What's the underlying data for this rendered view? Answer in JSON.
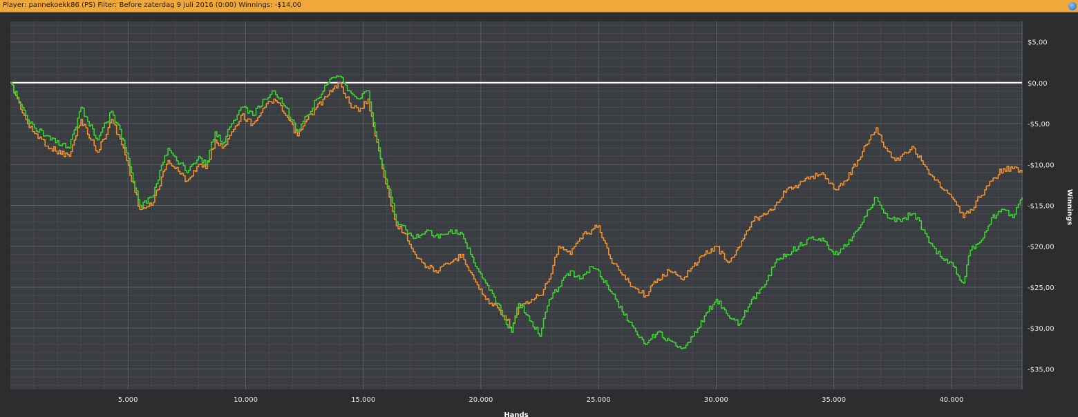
{
  "header": {
    "title": "Player: pannekoekk86 (PS) Filter: Before zaterdag 9 juli 2016 (0:00) Winnings: -$14,00"
  },
  "chart_data": {
    "type": "line",
    "xlabel": "Hands",
    "ylabel": "Winnings",
    "xlim": [
      0,
      43000
    ],
    "ylim": [
      -37.5,
      7.5
    ],
    "x_ticks": [
      5000,
      10000,
      15000,
      20000,
      25000,
      30000,
      35000,
      40000
    ],
    "x_tick_labels": [
      "5.000",
      "10.000",
      "15.000",
      "20.000",
      "25.000",
      "30.000",
      "35.000",
      "40.000"
    ],
    "y_ticks": [
      5,
      0,
      -5,
      -10,
      -15,
      -20,
      -25,
      -30,
      -35
    ],
    "y_tick_labels": [
      "$5,00",
      "$0,00",
      "-$5,00",
      "-$10,00",
      "-$15,00",
      "-$20,00",
      "-$25,00",
      "-$30,00",
      "-$35,00"
    ],
    "grid": true,
    "zero_line": 0,
    "colors": {
      "green": "#39d42f",
      "orange": "#f0912e",
      "zero": "#ffffff"
    },
    "series": [
      {
        "color": "green",
        "x": [
          0,
          800,
          1700,
          2500,
          3000,
          3700,
          4300,
          4800,
          5500,
          6000,
          6700,
          7500,
          8000,
          8300,
          8700,
          9000,
          9400,
          9800,
          10300,
          10800,
          11200,
          11700,
          12200,
          12600,
          13000,
          13500,
          14000,
          14400,
          14800,
          15200,
          15500,
          15800,
          16100,
          16400,
          16800,
          17200,
          17700,
          18200,
          18700,
          19200,
          19700,
          20200,
          20700,
          21000,
          21300,
          21600,
          22000,
          22500,
          22900,
          23300,
          23800,
          24200,
          24700,
          25000,
          25500,
          26000,
          26500,
          27000,
          27500,
          28000,
          28500,
          29000,
          29500,
          30000,
          30500,
          31000,
          31500,
          32000,
          32500,
          33000,
          33500,
          34000,
          34500,
          35000,
          35500,
          36000,
          36500,
          36800,
          37200,
          37600,
          38000,
          38400,
          38800,
          39200,
          39600,
          40000,
          40500,
          40800,
          41200,
          41700,
          42200,
          42600,
          43000
        ],
        "y": [
          0,
          -5,
          -7,
          -8,
          -3,
          -7,
          -3.5,
          -7,
          -15,
          -14,
          -8,
          -11,
          -9,
          -10,
          -6,
          -7.5,
          -5,
          -3,
          -4,
          -2,
          -1,
          -3,
          -6,
          -4,
          -2,
          0,
          0.8,
          -1,
          -2,
          -1,
          -6,
          -10,
          -13,
          -17,
          -18,
          -19,
          -18,
          -19,
          -18,
          -18.5,
          -22,
          -24.5,
          -27,
          -29,
          -30.5,
          -27,
          -28.5,
          -31,
          -26.5,
          -25,
          -23,
          -24,
          -22.5,
          -23,
          -25.5,
          -28,
          -30,
          -32,
          -30.5,
          -31.5,
          -32.5,
          -31,
          -28.5,
          -26.5,
          -28.5,
          -29.5,
          -26.5,
          -25,
          -22,
          -21,
          -20,
          -19,
          -19,
          -21,
          -20,
          -18,
          -15.5,
          -14,
          -16,
          -17,
          -16.5,
          -16,
          -18,
          -20,
          -21.5,
          -22,
          -24.5,
          -20.5,
          -19.5,
          -16.5,
          -15.5,
          -16.5,
          -14
        ]
      },
      {
        "color": "orange",
        "x": [
          0,
          800,
          1700,
          2500,
          3000,
          3700,
          4300,
          4800,
          5500,
          6000,
          6700,
          7500,
          8000,
          8300,
          8700,
          9000,
          9400,
          9800,
          10300,
          10800,
          11200,
          11700,
          12200,
          12600,
          13000,
          13500,
          14000,
          14400,
          14800,
          15200,
          15500,
          15800,
          16100,
          16400,
          16800,
          17200,
          17700,
          18200,
          18700,
          19200,
          19700,
          20200,
          20700,
          21000,
          21300,
          21600,
          22000,
          22500,
          22900,
          23300,
          23800,
          24200,
          24700,
          25000,
          25500,
          26000,
          26500,
          27000,
          27500,
          28000,
          28500,
          29000,
          29500,
          30000,
          30500,
          31000,
          31500,
          32000,
          32500,
          33000,
          33500,
          34000,
          34500,
          35000,
          35500,
          36000,
          36500,
          36800,
          37200,
          37600,
          38000,
          38400,
          38800,
          39200,
          39600,
          40000,
          40500,
          40800,
          41200,
          41700,
          42200,
          42600,
          43000
        ],
        "y": [
          0,
          -5.5,
          -8,
          -9,
          -4.5,
          -8.5,
          -4.5,
          -8,
          -15.5,
          -15,
          -9.5,
          -12,
          -10,
          -10.5,
          -7,
          -8,
          -6,
          -4,
          -5,
          -3,
          -2,
          -4,
          -6.5,
          -4.5,
          -3,
          -1.5,
          0,
          -2.5,
          -3.5,
          -2,
          -6.5,
          -10.5,
          -14,
          -17.5,
          -18.5,
          -21,
          -22.5,
          -23,
          -22,
          -21,
          -24,
          -26.5,
          -27.5,
          -28.5,
          -30,
          -27.5,
          -27,
          -26,
          -24,
          -20,
          -21,
          -19,
          -18,
          -17.5,
          -21.5,
          -23.5,
          -25,
          -26,
          -24,
          -23,
          -24,
          -22.5,
          -21,
          -20,
          -22,
          -20,
          -17,
          -16,
          -15,
          -13,
          -12.5,
          -11.5,
          -11,
          -13,
          -12,
          -9.5,
          -7,
          -5.5,
          -8,
          -9.5,
          -8.5,
          -8,
          -10,
          -11.5,
          -13,
          -14,
          -16.5,
          -15.5,
          -14,
          -12,
          -10.5,
          -10.5,
          -11
        ]
      }
    ]
  }
}
